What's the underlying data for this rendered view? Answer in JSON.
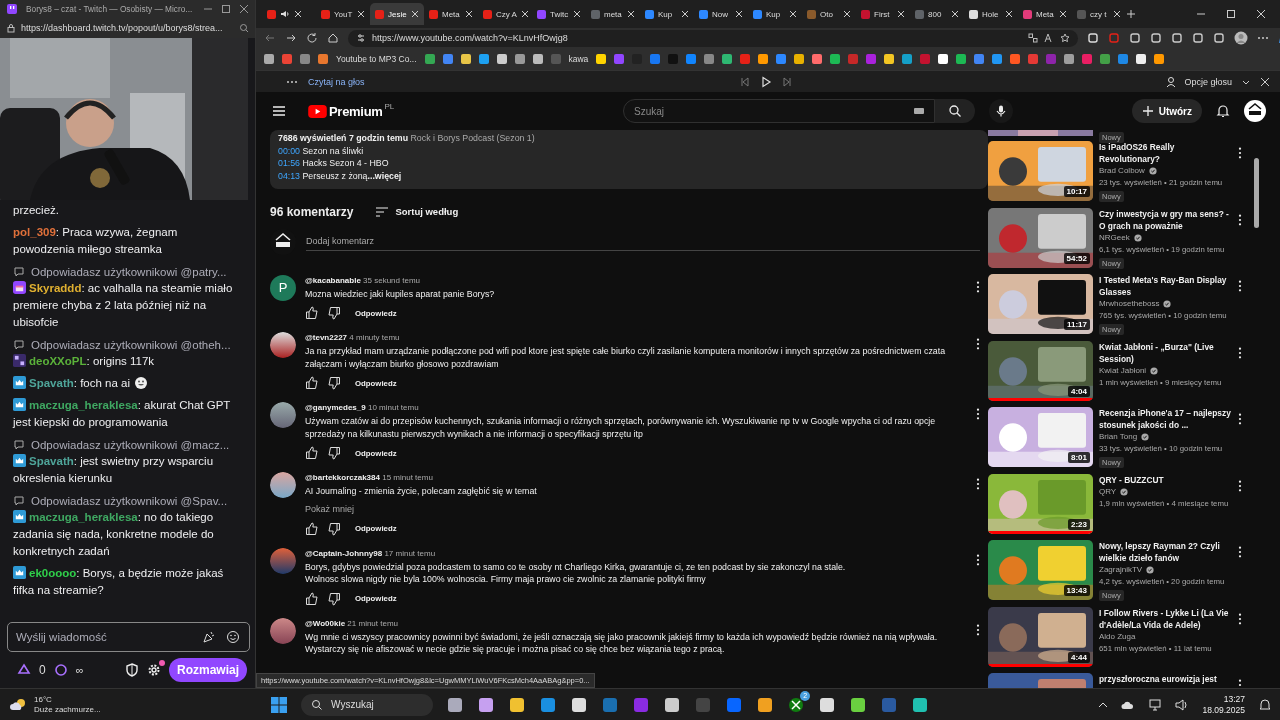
{
  "chat_window": {
    "title": "Borys8 – czat - Twitch — Osobisty — Micro...",
    "url": "https://dashboard.twitch.tv/popout/u/borys8/strea...",
    "messages": [
      {
        "kind": "continuation",
        "text": "przecież."
      },
      {
        "kind": "message",
        "user": "pol_309",
        "color": "#e0703a",
        "text": ": Praca wzywa, żegnam powodzenia miłego streamka"
      },
      {
        "kind": "message",
        "reply_to": "Odpowiadasz użytkownikowi @patry...",
        "user": "Skyraddd",
        "color": "#e0b030",
        "text": ": ac valhalla na steamie miało premiere chyba z 2 lata później niż na ubisofcie"
      },
      {
        "kind": "message",
        "reply_to": "Odpowiadasz użytkownikowi @otheh...",
        "user": "deoXXoPL",
        "color": "#5bb23a",
        "text": ": origins 117k"
      },
      {
        "kind": "message",
        "user": "Spavath",
        "color": "#4fa59a",
        "emote": true,
        "text": ": foch na ai"
      },
      {
        "kind": "message",
        "user": "maczuga_heraklesa",
        "color": "#3fa862",
        "text": ": akurat Chat GPT jest kiepski do programowania"
      },
      {
        "kind": "message",
        "reply_to": "Odpowiadasz użytkownikowi @macz...",
        "user": "Spavath",
        "color": "#4fa59a",
        "text": ": jest swietny przy wsparciu okreslenia kierunku"
      },
      {
        "kind": "message",
        "reply_to": "Odpowiadasz użytkownikowi @Spav...",
        "user": "maczuga_heraklesa",
        "color": "#3fa862",
        "text": ": no do takiego zadania się nada, konkretne modele do konkretnych zadań"
      },
      {
        "kind": "message",
        "user": "ek0oooo",
        "color": "#2fcf4a",
        "text": ": Borys, a będzie może jakaś fifka na streamie?"
      }
    ],
    "input": {
      "placeholder": "Wyślij wiadomość"
    },
    "points": "0",
    "points_extra": "∞",
    "chat_button": "Rozmawiaj",
    "settings_notification": true
  },
  "browser": {
    "tabs": [
      {
        "audio": true,
        "selected": false
      },
      {
        "label": "YouT",
        "audio": false,
        "selected": false
      },
      {
        "label": "Jesie",
        "audio": false,
        "selected": true
      },
      {
        "label": "Meta",
        "audio": false,
        "selected": false
      },
      {
        "label": "Czy A",
        "audio": false,
        "selected": false
      },
      {
        "label": "Twitc",
        "audio": false,
        "selected": false
      },
      {
        "label": "meta",
        "audio": false,
        "selected": false
      },
      {
        "label": "Kup",
        "audio": false,
        "selected": false
      },
      {
        "label": "Now",
        "audio": false,
        "selected": false
      },
      {
        "label": "Kup",
        "audio": false,
        "selected": false
      },
      {
        "label": "Oto",
        "audio": false,
        "selected": false
      },
      {
        "label": "First",
        "audio": false,
        "selected": false
      },
      {
        "label": "800",
        "audio": false,
        "selected": false
      },
      {
        "label": "Hole",
        "audio": false,
        "selected": false
      },
      {
        "label": "Meta",
        "audio": false,
        "selected": false
      },
      {
        "label": "czy t",
        "audio": false,
        "selected": false
      }
    ],
    "url": "https://www.youtube.com/watch?v=KLnvHfOwjg8",
    "bookmarks": [
      "Youtube to MP3 Co...",
      "kawa"
    ],
    "read_aloud": {
      "label": "Czytaj na głos",
      "options": "Opcje głosu"
    },
    "status_url": "https://www.youtube.com/watch?v=KLnvHfOwjg8&lc=UgwMMYLiWuV6FKcsMch4AaABAg&pp=0..."
  },
  "youtube": {
    "logo": "Premium",
    "region": "PL",
    "search_placeholder": "Szukaj",
    "create": "Utwórz",
    "description": {
      "stats": "7686 wyświetleń  7 godzin temu",
      "tags": "Rock i Borys Podcast (Sezon 1)",
      "chapters": [
        {
          "time": "00:00",
          "title": "Sezon na śliwki"
        },
        {
          "time": "01:56",
          "title": "Hacks Sezon 4 - HBO"
        },
        {
          "time": "04:13",
          "title": "Perseusz z żoną"
        }
      ],
      "more": "...więcej"
    },
    "comments_count": "96 komentarzy",
    "sort": "Sortuj według",
    "comment_field": {
      "placeholder": "Dodaj komentarz"
    },
    "comments": [
      {
        "avatar_letter": "P",
        "author": "@kacabanable",
        "time": "35 sekund temu",
        "lines": [
          "Mozna wiedziec jaki kupiles aparat panie Borys?"
        ],
        "reply": "Odpowiedz"
      },
      {
        "author": "@tevn2227",
        "time": "4 minuty temu",
        "lines": [
          "Ja na przykład mam urządzanie  podłączone pod wifi pod ktore jest spięte całe biurko czyli zasilanie komputera monitorów i innych sprzętów za pośrednictwem  czata",
          "załączam i wyłączam biurko głosowo pozdrawiam"
        ],
        "reply": "Odpowiedz"
      },
      {
        "author": "@ganymedes_9",
        "time": "10 minut temu",
        "lines": [
          "Używam czatów ai do przepisów kuchennych, szukania informacji o różnych sprzętach, porównywanie ich. Wyszukiwanie np tv w Google wpycha ci od razu opcje",
          "sprzedaży na kilkunastu pierwszych wynikach a nie informacji o specyfikacji sprzętu itp"
        ],
        "reply": "Odpowiedz"
      },
      {
        "author": "@bartekkorczak384",
        "time": "15 minut temu",
        "lines": [
          "AI Journaling - zmienia życie, polecam zagłębić się w temat"
        ],
        "less": "Pokaż mniej",
        "reply": "Odpowiedz"
      },
      {
        "author": "@Captain-Johnny98",
        "time": "17 minut temu",
        "lines": [
          "Borys, gdybys powiedzial poza podcastem to samo co te osoby nt Charliego Kirka, gwarantuje ci, ze ten podcast by sie zakonczyl na stale.",
          "Wolnosc slowa nigdy nie byla 100% wolnoscia. Firmy maja prawo cie zwolnic za zlamanie polityki firmy"
        ],
        "reply": "Odpowiedz"
      },
      {
        "author": "@Wo00kie",
        "time": "21 minut temu",
        "lines": [
          "Wg mnie ci wszyscy pracownicy powinni być świadomi, że jeśli oznaczają się jako pracownik jakiejś firmy to każda ich wypowiedź będzie również na nią wpływała.",
          "Wystarczy się nie afiszować w necie gdzie się pracuje i można pisać co się chce bez wiązania tego z pracą."
        ]
      }
    ],
    "sidebar": {
      "top_badge": "Nowy",
      "videos": [
        {
          "title": "Is iPadOS26 Really Revolutionary?",
          "channel": "Brad Colbow",
          "verified": true,
          "stats": "23 tys. wyświetleń • 21 godzin temu",
          "badge": "Nowy",
          "duration": "10:17"
        },
        {
          "title": "Czy inwestycja w gry ma sens? - O grach na poważnie",
          "channel": "NRGeek",
          "verified": true,
          "stats": "6,1 tys. wyświetleń • 19 godzin temu",
          "badge": "Nowy",
          "duration": "54:52"
        },
        {
          "title": "I Tested Meta's Ray-Ban Display Glasses",
          "channel": "Mrwhosetheboss",
          "verified": true,
          "stats": "765 tys. wyświetleń • 10 godzin temu",
          "badge": "Nowy",
          "duration": "11:17"
        },
        {
          "title": "Kwiat Jabłoni - „Burza\" (Live Session)",
          "channel": "Kwiat Jabłoni",
          "verified": true,
          "stats": "1 mln wyświetleń • 9 miesięcy temu",
          "duration": "4:04",
          "watched": true
        },
        {
          "title": "Recenzja iPhone'a 17 – najlepszy stosunek jakości do ...",
          "channel": "Brian Tong",
          "verified": true,
          "stats": "33 tys. wyświetleń • 10 godzin temu",
          "badge": "Nowy",
          "duration": "8:01"
        },
        {
          "title": "QRY - BUZZCUT",
          "channel": "QRY",
          "verified": true,
          "stats": "1,9 mln wyświetleń • 4 miesiące temu",
          "duration": "2:23",
          "watched": true
        },
        {
          "title": "Nowy, lepszy Rayman 2? Czyli wielkie dzieło fanów",
          "channel": "ZagrajnikTV",
          "verified": true,
          "stats": "4,2 tys. wyświetleń • 20 godzin temu",
          "badge": "Nowy",
          "duration": "13:43"
        },
        {
          "title": "I Follow Rivers - Lykke Li (La Vie d'Adèle/La Vida de Adele)",
          "channel": "Aldo Zuga",
          "stats": "651 mln wyświetleń • 11 lat temu",
          "duration": "4:44",
          "watched": true
        },
        {
          "title": "przyszłoroczna eurowizja jest"
        }
      ]
    }
  },
  "taskbar": {
    "weather_temp": "16°C",
    "weather_text": "Duże zachmurze...",
    "search": "Wyszukaj",
    "xbox_badge": "2",
    "time": "13:27",
    "date": "18.09.2025"
  }
}
